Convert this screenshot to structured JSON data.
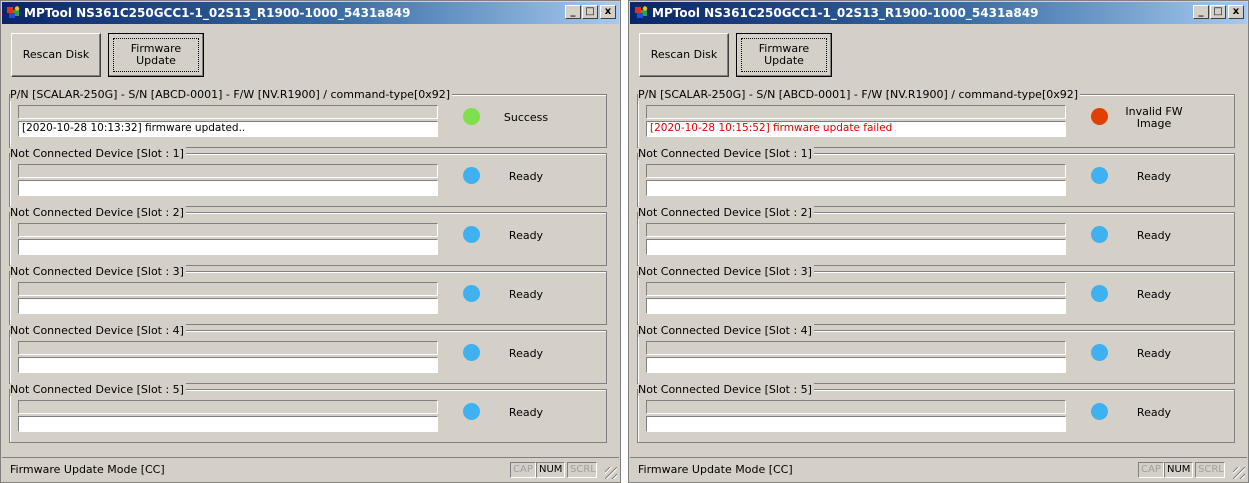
{
  "colors": {
    "success": "#7ee04a",
    "ready": "#3fb0f0",
    "error": "#e04000"
  },
  "windows": [
    {
      "title": "MPTool NS361C250GCC1-1_02S13_R1900-1000_5431a849",
      "title_buttons": [
        "_",
        "□",
        "x"
      ],
      "rescan_label": "Rescan Disk",
      "fw_line1": "Firmware",
      "fw_line2": "Update",
      "slots": [
        {
          "label": "P/N [SCALAR-250G] - S/N [ABCD-0001] - F/W [NV.R1900] / command-type[0x92]",
          "log": "[2020-10-28 10:13:32] firmware updated..",
          "status1": "Success",
          "status2": "",
          "state": "success"
        },
        {
          "label": "Not Connected Device [Slot : 1]",
          "log": "",
          "status1": "Ready",
          "status2": "",
          "state": "ready"
        },
        {
          "label": "Not Connected Device [Slot : 2]",
          "log": "",
          "status1": "Ready",
          "status2": "",
          "state": "ready"
        },
        {
          "label": "Not Connected Device [Slot : 3]",
          "log": "",
          "status1": "Ready",
          "status2": "",
          "state": "ready"
        },
        {
          "label": "Not Connected Device [Slot : 4]",
          "log": "",
          "status1": "Ready",
          "status2": "",
          "state": "ready"
        },
        {
          "label": "Not Connected Device [Slot : 5]",
          "log": "",
          "status1": "Ready",
          "status2": "",
          "state": "ready"
        }
      ],
      "statusbar": {
        "mode": "Firmware Update Mode [CC]",
        "cap": "CAP",
        "num": "NUM",
        "scrl": "SCRL"
      }
    },
    {
      "title": "MPTool NS361C250GCC1-1_02S13_R1900-1000_5431a849",
      "title_buttons": [
        "_",
        "□",
        "x"
      ],
      "rescan_label": "Rescan Disk",
      "fw_line1": "Firmware",
      "fw_line2": "Update",
      "slots": [
        {
          "label": "P/N [SCALAR-250G] - S/N [ABCD-0001] - F/W [NV.R1900] / command-type[0x92]",
          "log": "[2020-10-28 10:15:52] firmware update failed",
          "status1": "Invalid FW",
          "status2": "Image",
          "state": "error"
        },
        {
          "label": "Not Connected Device [Slot : 1]",
          "log": "",
          "status1": "Ready",
          "status2": "",
          "state": "ready"
        },
        {
          "label": "Not Connected Device [Slot : 2]",
          "log": "",
          "status1": "Ready",
          "status2": "",
          "state": "ready"
        },
        {
          "label": "Not Connected Device [Slot : 3]",
          "log": "",
          "status1": "Ready",
          "status2": "",
          "state": "ready"
        },
        {
          "label": "Not Connected Device [Slot : 4]",
          "log": "",
          "status1": "Ready",
          "status2": "",
          "state": "ready"
        },
        {
          "label": "Not Connected Device [Slot : 5]",
          "log": "",
          "status1": "Ready",
          "status2": "",
          "state": "ready"
        }
      ],
      "statusbar": {
        "mode": "Firmware Update Mode [CC]",
        "cap": "CAP",
        "num": "NUM",
        "scrl": "SCRL"
      }
    }
  ]
}
